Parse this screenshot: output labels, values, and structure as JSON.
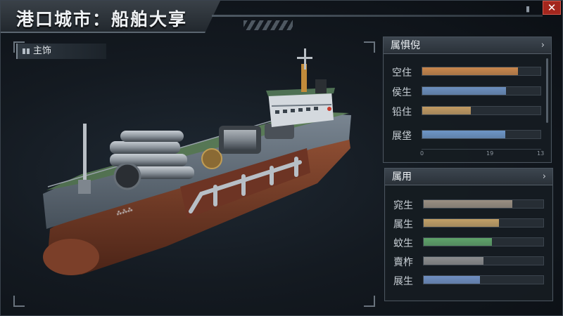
{
  "header": {
    "title": "港口城市：船舶大享",
    "close_label": "✕",
    "pin_icon": "pin-icon"
  },
  "viewport": {
    "mode_tab_label": "主饰"
  },
  "panel_main": {
    "title": "属惧倪",
    "stats": [
      {
        "label": "空住",
        "value": 0.81,
        "color": "#c9874c"
      },
      {
        "label": "侯生",
        "value": 0.71,
        "color": "#6c8fbe"
      },
      {
        "label": "铅住",
        "value": 0.41,
        "color": "#c29b63"
      },
      {
        "label": "展垡",
        "value": 0.7,
        "color": "#6e96c7"
      }
    ],
    "axis_ticks": [
      "0",
      "19",
      "13"
    ]
  },
  "panel_use": {
    "title": "属用",
    "stats": [
      {
        "label": "窕生",
        "value": 0.74,
        "color": "#9a8f82"
      },
      {
        "label": "属生",
        "value": 0.63,
        "color": "#c1a067"
      },
      {
        "label": "蚊生",
        "value": 0.57,
        "color": "#5fa36a"
      },
      {
        "label": "賣柞",
        "value": 0.5,
        "color": "#8c8d8e"
      },
      {
        "label": "展生",
        "value": 0.47,
        "color": "#6f8fc2"
      }
    ]
  }
}
